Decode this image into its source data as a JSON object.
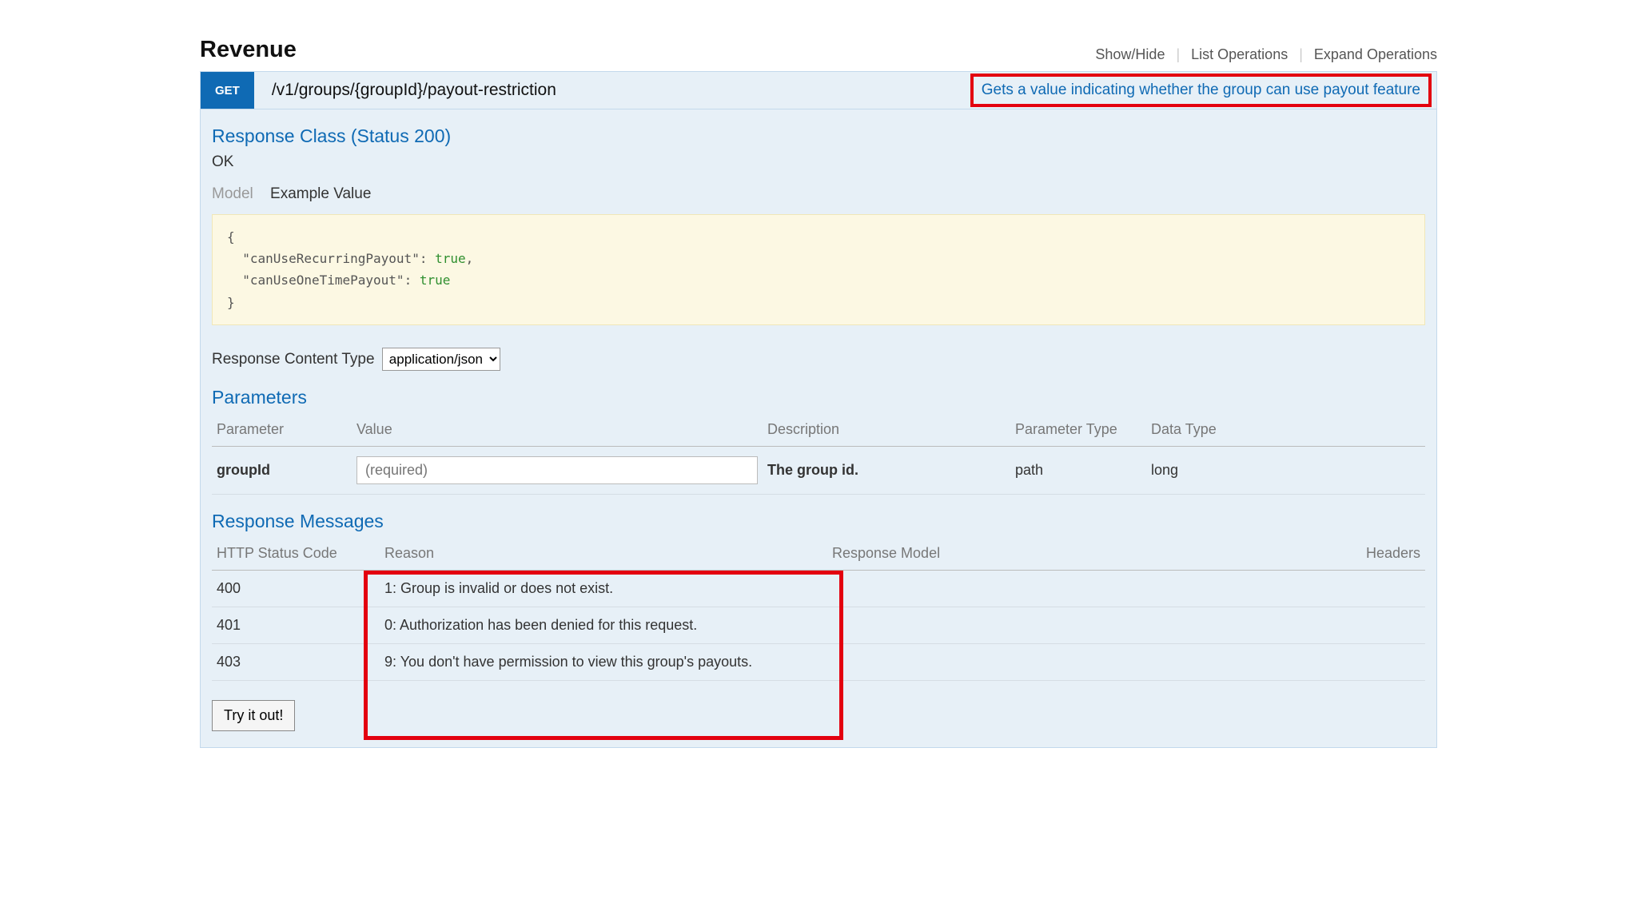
{
  "header": {
    "title": "Revenue",
    "links": [
      "Show/Hide",
      "List Operations",
      "Expand Operations"
    ]
  },
  "operation": {
    "method": "GET",
    "path": "/v1/groups/{groupId}/payout-restriction",
    "summary": "Gets a value indicating whether the group can use payout feature"
  },
  "response_class": {
    "heading": "Response Class (Status 200)",
    "status_text": "OK",
    "tabs": {
      "model": "Model",
      "example": "Example Value"
    },
    "example_json": "{\n  \"canUseRecurringPayout\": true,\n  \"canUseOneTimePayout\": true\n}"
  },
  "response_content_type": {
    "label": "Response Content Type",
    "selected": "application/json"
  },
  "parameters": {
    "heading": "Parameters",
    "columns": [
      "Parameter",
      "Value",
      "Description",
      "Parameter Type",
      "Data Type"
    ],
    "rows": [
      {
        "name": "groupId",
        "placeholder": "(required)",
        "description": "The group id.",
        "param_type": "path",
        "data_type": "long"
      }
    ]
  },
  "response_messages": {
    "heading": "Response Messages",
    "columns": [
      "HTTP Status Code",
      "Reason",
      "Response Model",
      "Headers"
    ],
    "rows": [
      {
        "code": "400",
        "reason": "1: Group is invalid or does not exist."
      },
      {
        "code": "401",
        "reason": "0: Authorization has been denied for this request."
      },
      {
        "code": "403",
        "reason": "9: You don't have permission to view this group's payouts."
      }
    ]
  },
  "try_it": "Try it out!"
}
